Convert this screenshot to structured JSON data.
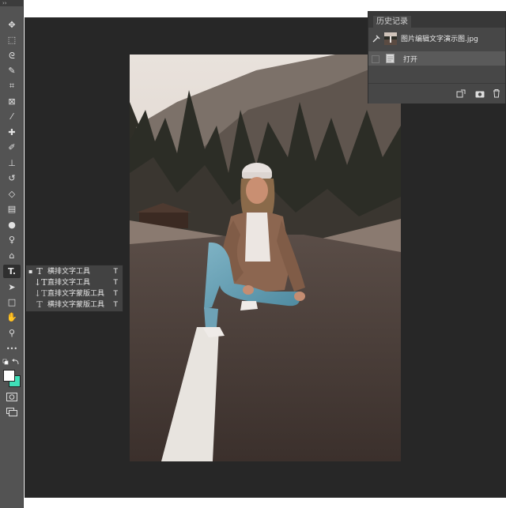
{
  "toolbar": {
    "grip": "››",
    "tools": [
      {
        "name": "move-tool",
        "glyph": "✥"
      },
      {
        "name": "marquee-tool",
        "glyph": "⬚"
      },
      {
        "name": "lasso-tool",
        "glyph": "ᘓ"
      },
      {
        "name": "quick-select-tool",
        "glyph": "✎"
      },
      {
        "name": "crop-tool",
        "glyph": "⌗"
      },
      {
        "name": "frame-tool",
        "glyph": "⊠"
      },
      {
        "name": "eyedropper-tool",
        "glyph": "⁄"
      },
      {
        "name": "healing-brush-tool",
        "glyph": "✚"
      },
      {
        "name": "brush-tool",
        "glyph": "✐"
      },
      {
        "name": "clone-stamp-tool",
        "glyph": "⊥"
      },
      {
        "name": "history-brush-tool",
        "glyph": "↺"
      },
      {
        "name": "eraser-tool",
        "glyph": "◇"
      },
      {
        "name": "gradient-tool",
        "glyph": "▤"
      },
      {
        "name": "blur-tool",
        "glyph": "●"
      },
      {
        "name": "dodge-tool",
        "glyph": "♀"
      },
      {
        "name": "pen-tool",
        "glyph": "⌂"
      },
      {
        "name": "type-tool",
        "glyph": "T."
      },
      {
        "name": "path-select-tool",
        "glyph": "➤"
      },
      {
        "name": "rectangle-tool",
        "glyph": "□"
      },
      {
        "name": "hand-tool",
        "glyph": "✋"
      },
      {
        "name": "zoom-tool",
        "glyph": "⚲"
      },
      {
        "name": "more-tools",
        "glyph": "•••"
      }
    ],
    "foreground_color": "#ffffff",
    "background_color": "#3fe0b8"
  },
  "history_panel": {
    "tab_title": "历史记录",
    "snapshot_label": "图片编辑文字演示图.jpg",
    "step_label": "打开"
  },
  "flyout": {
    "items": [
      {
        "icon": "T",
        "label": "横排文字工具",
        "key": "T",
        "selected": "▪"
      },
      {
        "icon": "↓T",
        "label": "直排文字工具",
        "key": "T",
        "selected": ""
      },
      {
        "icon": "↓T",
        "label": "直排文字蒙版工具",
        "key": "T",
        "selected": ""
      },
      {
        "icon": "T",
        "label": "横排文字蒙版工具",
        "key": "T",
        "selected": ""
      }
    ]
  }
}
